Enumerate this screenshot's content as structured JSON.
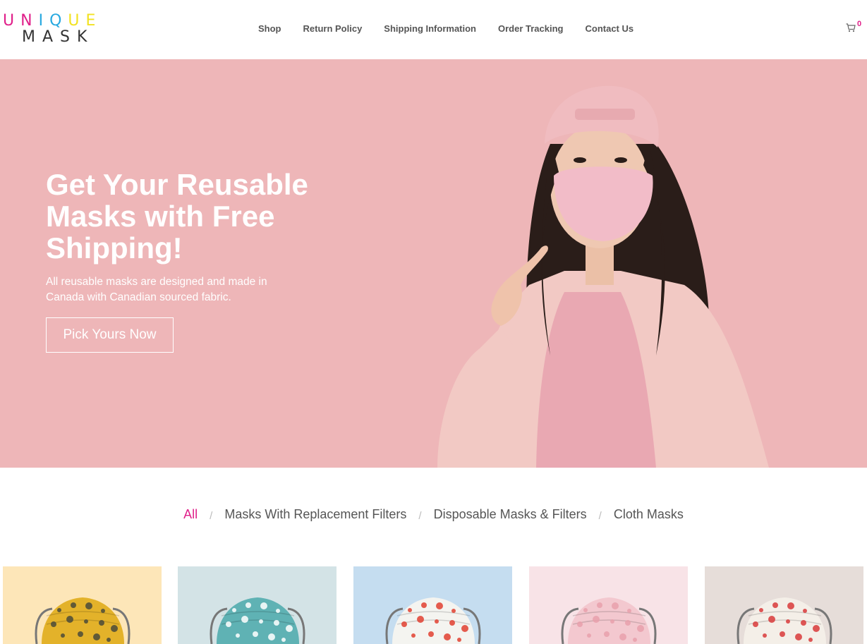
{
  "brand": {
    "letters_top": [
      "U",
      "N",
      "I",
      "Q",
      "U",
      "E"
    ],
    "letter_colors": [
      "#e0208a",
      "#e0208a",
      "#28a9e0",
      "#28a9e0",
      "#f2e222",
      "#f2e222"
    ],
    "bottom": "MASK"
  },
  "nav": {
    "items": [
      "Shop",
      "Return Policy",
      "Shipping Information",
      "Order Tracking",
      "Contact Us"
    ]
  },
  "cart": {
    "count": "0",
    "icon": "cart-icon"
  },
  "hero": {
    "title": "Get Your Reusable Masks with Free Shipping!",
    "subtitle": "All reusable masks are designed and made in Canada with Canadian sourced fabric.",
    "button": "Pick Yours Now",
    "background": "#eeb6b8"
  },
  "filters": {
    "items": [
      "All",
      "Masks With Replacement Filters",
      "Disposable Masks & Filters",
      "Cloth Masks"
    ],
    "active": "All",
    "separator": "/"
  },
  "colors": {
    "accent": "#e0208a",
    "nav_text": "#555555"
  },
  "products": [
    {
      "bg": "#fde6b8",
      "mask": "#e3b22a",
      "pattern": "#4a4a3a"
    },
    {
      "bg": "#d3e3e6",
      "mask": "#5fb2b4",
      "pattern": "#ffffff"
    },
    {
      "bg": "#c5ddf0",
      "mask": "#f4f4f0",
      "pattern": "#e04030"
    },
    {
      "bg": "#f8e3e7",
      "mask": "#f3c8cf",
      "pattern": "#e8a0ac"
    },
    {
      "bg": "#e6ddd9",
      "mask": "#f4efe8",
      "pattern": "#d83a3a"
    }
  ]
}
